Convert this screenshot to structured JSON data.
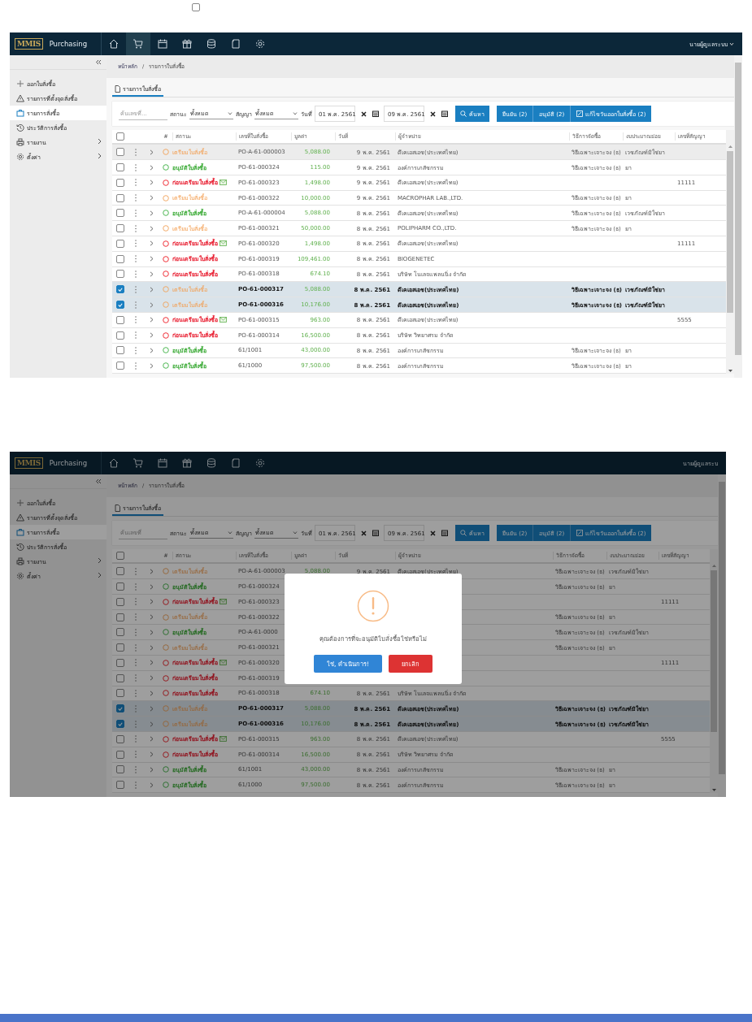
{
  "top_checkbox": {
    "checked": false
  },
  "screens": [
    {
      "header": {
        "logo_text": "MMIS",
        "app_title": "Purchasing",
        "user": "นายผู้ดูแลระบบ",
        "caret": true
      },
      "nav": [
        {
          "selected": false
        },
        {
          "selected": true
        },
        {
          "selected": false
        },
        {
          "selected": false
        },
        {
          "selected": false
        },
        {
          "selected": false
        },
        {
          "selected": false
        }
      ],
      "sidebar": [
        {
          "label": "ออกใบสั่งซื้อ",
          "selected": false,
          "expandable": false
        },
        {
          "label": "รายการที่ตั้งจุดสั่งซื้อ",
          "selected": false,
          "expandable": false
        },
        {
          "label": "รายการสั่งซื้อ",
          "selected": true,
          "expandable": false
        },
        {
          "label": "ประวัติการสั่งซื้อ",
          "selected": false,
          "expandable": false
        },
        {
          "label": "รายงาน",
          "selected": false,
          "expandable": true
        },
        {
          "label": "ตั้งค่า",
          "selected": false,
          "expandable": true
        }
      ],
      "breadcrumb": {
        "home": "หน้าหลัก",
        "separator": "/",
        "current": "รายการใบสั่งซื้อ"
      },
      "tabs": [
        {
          "label": "รายการใบสั่งซื้อ",
          "selected": true
        }
      ],
      "filter": {
        "search_placeholder": "ค้นเลขที่...",
        "status_label": "สถานะ",
        "status_value": "ทั้งหมด",
        "contract_label": "สัญญา",
        "contract_value": "ทั้งหมด",
        "date_label": "วันที่",
        "date_from": "01 พ.ค. 2561",
        "date_to": "09 พ.ค. 2561",
        "search_button": "ค้นหา",
        "actions": [
          "ยืนยัน (2)",
          "อนุมัติ (2)",
          "แก้ไขวันออกใบสั่งซื้อ (2)"
        ]
      },
      "table": {
        "all_checked": false,
        "columns": [
          "#",
          "สถานะ",
          "เลขที่ใบสั่งซื้อ",
          "มูลค่า",
          "วันที่",
          "ผู้จำหน่าย",
          "วิธีการจัดซื้อ",
          "งบประมาณย่อย",
          "เลขที่สัญญา"
        ],
        "rows": [
          {
            "selected": false,
            "highlighted": true,
            "status": {
              "kind": "prepare",
              "label": "เตรียมใบสั่งซื้อ"
            },
            "mail": false,
            "po": "PO-A-61-000003",
            "value": "5,088.00",
            "date": "9 พ.ค. 2561",
            "vendor": "ดีเคเอสเอช(ประเทศไทย)",
            "method": "วิธีเฉพาะเจาะจง (ธ)",
            "budget": "เวชภัณฑ์มิใช่ยา"
          },
          {
            "selected": false,
            "highlighted": false,
            "status": {
              "kind": "approved",
              "label": "อนุมัติใบสั่งซื้อ"
            },
            "mail": false,
            "po": "PO-61-000324",
            "value": "115.00",
            "date": "9 พ.ค. 2561",
            "vendor": "องค์การเภสัชกรรม",
            "method": "วิธีเฉพาะเจาะจง (ธ)",
            "budget": "ยา"
          },
          {
            "selected": false,
            "highlighted": false,
            "status": {
              "kind": "draft",
              "label": "ก่อนเตรียมใบสั่งซื้อ"
            },
            "mail": true,
            "po": "PO-61-000323",
            "value": "1,498.00",
            "date": "9 พ.ค. 2561",
            "vendor": "ดีเคเอสเอช(ประเทศไทย)",
            "contract": "11111"
          },
          {
            "selected": false,
            "highlighted": false,
            "status": {
              "kind": "prepare",
              "label": "เตรียมใบสั่งซื้อ"
            },
            "mail": false,
            "po": "PO-61-000322",
            "value": "10,000.00",
            "date": "9 พ.ค. 2561",
            "vendor": "MACROPHAR LAB.,LTD.",
            "method": "วิธีเฉพาะเจาะจง (ธ)",
            "budget": "ยา"
          },
          {
            "selected": false,
            "highlighted": false,
            "status": {
              "kind": "approved",
              "label": "อนุมัติใบสั่งซื้อ"
            },
            "mail": false,
            "po": "PO-A-61-000004",
            "value": "5,088.00",
            "date": "8 พ.ค. 2561",
            "vendor": "ดีเคเอสเอช(ประเทศไทย)",
            "method": "วิธีเฉพาะเจาะจง (ธ)",
            "budget": "เวชภัณฑ์มิใช่ยา"
          },
          {
            "selected": false,
            "highlighted": false,
            "status": {
              "kind": "prepare",
              "label": "เตรียมใบสั่งซื้อ"
            },
            "mail": false,
            "po": "PO-61-000321",
            "value": "50,000.00",
            "date": "8 พ.ค. 2561",
            "vendor": "POLIPHARM CO.,LTD.",
            "method": "วิธีเฉพาะเจาะจง (ธ)",
            "budget": "ยา"
          },
          {
            "selected": false,
            "highlighted": false,
            "status": {
              "kind": "draft",
              "label": "ก่อนเตรียมใบสั่งซื้อ"
            },
            "mail": true,
            "po": "PO-61-000320",
            "value": "1,498.00",
            "date": "8 พ.ค. 2561",
            "vendor": "ดีเคเอสเอช(ประเทศไทย)",
            "contract": "11111"
          },
          {
            "selected": false,
            "highlighted": false,
            "status": {
              "kind": "draft",
              "label": "ก่อนเตรียมใบสั่งซื้อ"
            },
            "mail": false,
            "po": "PO-61-000319",
            "value": "109,461.00",
            "date": "8 พ.ค. 2561",
            "vendor": "BIOGENETEC"
          },
          {
            "selected": false,
            "highlighted": false,
            "status": {
              "kind": "draft",
              "label": "ก่อนเตรียมใบสั่งซื้อ"
            },
            "mail": false,
            "po": "PO-61-000318",
            "value": "674.10",
            "date": "8 พ.ค. 2561",
            "vendor": "บริษัท โนเลจแพลนนิ่ง จำกัด"
          },
          {
            "selected": true,
            "highlighted": false,
            "status": {
              "kind": "prepare",
              "label": "เตรียมใบสั่งซื้อ"
            },
            "mail": false,
            "po": "PO-61-000317",
            "value": "5,088.00",
            "date": "8 พ.ค. 2561",
            "vendor": "ดีเคเอสเอช(ประเทศไทย)",
            "method": "วิธีเฉพาะเจาะจง (ธ)",
            "budget": "เวชภัณฑ์มิใช่ยา"
          },
          {
            "selected": true,
            "highlighted": false,
            "status": {
              "kind": "prepare",
              "label": "เตรียมใบสั่งซื้อ"
            },
            "mail": false,
            "po": "PO-61-000316",
            "value": "10,176.00",
            "date": "8 พ.ค. 2561",
            "vendor": "ดีเคเอสเอช(ประเทศไทย)",
            "method": "วิธีเฉพาะเจาะจง (ธ)",
            "budget": "เวชภัณฑ์มิใช่ยา"
          },
          {
            "selected": false,
            "highlighted": false,
            "status": {
              "kind": "draft",
              "label": "ก่อนเตรียมใบสั่งซื้อ"
            },
            "mail": true,
            "po": "PO-61-000315",
            "value": "963.00",
            "date": "8 พ.ค. 2561",
            "vendor": "ดีเคเอสเอช(ประเทศไทย)",
            "contract": "5555"
          },
          {
            "selected": false,
            "highlighted": false,
            "status": {
              "kind": "draft",
              "label": "ก่อนเตรียมใบสั่งซื้อ"
            },
            "mail": false,
            "po": "PO-61-000314",
            "value": "16,500.00",
            "date": "8 พ.ค. 2561",
            "vendor": "บริษัท วิทยาศรม จำกัด"
          },
          {
            "selected": false,
            "highlighted": false,
            "status": {
              "kind": "approved",
              "label": "อนุมัติใบสั่งซื้อ"
            },
            "mail": false,
            "po": "61/1001",
            "value": "43,000.00",
            "date": "8 พ.ค. 2561",
            "vendor": "องค์การเภสัชกรรม",
            "method": "วิธีเฉพาะเจาะจง (ธ)",
            "budget": "ยา"
          },
          {
            "selected": false,
            "highlighted": false,
            "status": {
              "kind": "approved",
              "label": "อนุมัติใบสั่งซื้อ"
            },
            "mail": false,
            "po": "61/1000",
            "value": "97,500.00",
            "date": "8 พ.ค. 2561",
            "vendor": "องค์การเภสัชกรรม",
            "method": "วิธีเฉพาะเจาะจง (ธ)",
            "budget": "ยา"
          }
        ]
      }
    },
    {
      "header": {
        "logo_text": "MMIS",
        "app_title": "Purchasing",
        "user": "นายผู้ดูแลระบ",
        "caret": false
      },
      "nav": [
        {
          "selected": false
        },
        {
          "selected": false
        },
        {
          "selected": false
        },
        {
          "selected": false
        },
        {
          "selected": false
        },
        {
          "selected": false
        },
        {
          "selected": false
        }
      ],
      "sidebar": [
        {
          "label": "ออกใบสั่งซื้อ",
          "selected": false,
          "expandable": false
        },
        {
          "label": "รายการที่ตั้งจุดสั่งซื้อ",
          "selected": false,
          "expandable": false
        },
        {
          "label": "รายการสั่งซื้อ",
          "selected": true,
          "expandable": false
        },
        {
          "label": "ประวัติการสั่งซื้อ",
          "selected": false,
          "expandable": false
        },
        {
          "label": "รายงาน",
          "selected": false,
          "expandable": true
        },
        {
          "label": "ตั้งค่า",
          "selected": false,
          "expandable": true
        }
      ],
      "breadcrumb": {
        "home": "หน้าหลัก",
        "separator": "/",
        "current": "รายการใบสั่งซื้อ"
      },
      "tabs": [
        {
          "label": "รายการใบสั่งซื้อ",
          "selected": true
        }
      ],
      "filter": {
        "search_placeholder": "ค้นเลขที่",
        "status_label": "สถานะ",
        "status_value": "ทั้งหมด",
        "contract_label": "สัญญา",
        "contract_value": "ทั้งหมด",
        "date_label": "วันที่",
        "date_from": "01 พ.ค. 2561",
        "date_to": "09 พ.ค. 2561",
        "search_button": "ค้นหา",
        "actions": [
          "ยืนยัน (2)",
          "อนุมัติ (2)",
          "แก้ไขวันออกใบสั่งซื้อ (2)"
        ]
      },
      "table": {
        "all_checked": false,
        "columns": [
          "#",
          "สถานะ",
          "เลขที่ใบสั่งซื้อ",
          "มูลค่า",
          "วันที่",
          "ผู้จำหน่าย",
          "วิธีการจัดซื้อ",
          "งบประมาณย่อย",
          "เลขที่สัญญา"
        ],
        "rows": [
          {
            "selected": false,
            "highlighted": false,
            "status": {
              "kind": "prepare",
              "label": "เตรียมใบสั่งซื้อ"
            },
            "mail": false,
            "po": "PO-A-61-000003",
            "value": "5,088.00",
            "date": "9 พ.ค. 2561",
            "vendor": "ดีเคเอสเอช(ประเทศไทย)",
            "method": "วิธีเฉพาะเจาะจง (ธ)",
            "budget": "เวชภัณฑ์มิใช่ยา"
          },
          {
            "selected": false,
            "highlighted": false,
            "status": {
              "kind": "approved",
              "label": "อนุมัติใบสั่งซื้อ"
            },
            "mail": false,
            "po": "PO-61-000324",
            "method": "วิธีเฉพาะเจาะจง (ธ)",
            "budget": "ยา"
          },
          {
            "selected": false,
            "highlighted": false,
            "status": {
              "kind": "draft",
              "label": "ก่อนเตรียมใบสั่งซื้อ"
            },
            "mail": true,
            "po": "PO-61-000323",
            "contract": "11111"
          },
          {
            "selected": false,
            "highlighted": false,
            "status": {
              "kind": "prepare",
              "label": "เตรียมใบสั่งซื้อ"
            },
            "mail": false,
            "po": "PO-61-000322",
            "method": "วิธีเฉพาะเจาะจง (ธ)",
            "budget": "ยา"
          },
          {
            "selected": false,
            "highlighted": false,
            "status": {
              "kind": "approved",
              "label": "อนุมัติใบสั่งซื้อ"
            },
            "mail": false,
            "po": "PO-A-61-0000",
            "method": "วิธีเฉพาะเจาะจง (ธ)",
            "budget": "เวชภัณฑ์มิใช่ยา"
          },
          {
            "selected": false,
            "highlighted": false,
            "status": {
              "kind": "prepare",
              "label": "เตรียมใบสั่งซื้อ"
            },
            "mail": false,
            "po": "PO-61-000321",
            "method": "วิธีเฉพาะเจาะจง (ธ)",
            "budget": "ยา"
          },
          {
            "selected": false,
            "highlighted": false,
            "status": {
              "kind": "draft",
              "label": "ก่อนเตรียมใบสั่งซื้อ"
            },
            "mail": true,
            "po": "PO-61-000320",
            "contract": "11111"
          },
          {
            "selected": false,
            "highlighted": false,
            "status": {
              "kind": "draft",
              "label": "ก่อนเตรียมใบสั่งซื้อ"
            },
            "mail": false,
            "po": "PO-61-000319"
          },
          {
            "selected": false,
            "highlighted": false,
            "status": {
              "kind": "draft",
              "label": "ก่อนเตรียมใบสั่งซื้อ"
            },
            "mail": false,
            "po": "PO-61-000318",
            "value": "674.10",
            "date": "8 พ.ค. 2561",
            "vendor": "บริษัท โนเลจแพลนนิ่ง จำกัด"
          },
          {
            "selected": true,
            "highlighted": false,
            "status": {
              "kind": "prepare",
              "label": "เตรียมใบสั่งซื้อ"
            },
            "mail": false,
            "po": "PO-61-000317",
            "value": "5,088.00",
            "date": "8 พ.ค. 2561",
            "vendor": "ดีเคเอสเอช(ประเทศไทย)",
            "method": "วิธีเฉพาะเจาะจง (ธ)",
            "budget": "เวชภัณฑ์มิใช่ยา"
          },
          {
            "selected": true,
            "highlighted": false,
            "status": {
              "kind": "prepare",
              "label": "เตรียมใบสั่งซื้อ"
            },
            "mail": false,
            "po": "PO-61-000316",
            "value": "10,176.00",
            "date": "8 พ.ค. 2561",
            "vendor": "ดีเคเอสเอช(ประเทศไทย)",
            "method": "วิธีเฉพาะเจาะจง (ธ)",
            "budget": "เวชภัณฑ์มิใช่ยา"
          },
          {
            "selected": false,
            "highlighted": false,
            "status": {
              "kind": "draft",
              "label": "ก่อนเตรียมใบสั่งซื้อ"
            },
            "mail": true,
            "po": "PO-61-000315",
            "value": "963.00",
            "date": "8 พ.ค. 2561",
            "vendor": "ดีเคเอสเอช(ประเทศไทย)",
            "contract": "5555"
          },
          {
            "selected": false,
            "highlighted": false,
            "status": {
              "kind": "draft",
              "label": "ก่อนเตรียมใบสั่งซื้อ"
            },
            "mail": false,
            "po": "PO-61-000314",
            "value": "16,500.00",
            "date": "8 พ.ค. 2561",
            "vendor": "บริษัท วิทยาศรม จำกัด"
          },
          {
            "selected": false,
            "highlighted": false,
            "status": {
              "kind": "approved",
              "label": "อนุมัติใบสั่งซื้อ"
            },
            "mail": false,
            "po": "61/1001",
            "value": "43,000.00",
            "date": "8 พ.ค. 2561",
            "vendor": "องค์การเภสัชกรรม",
            "method": "วิธีเฉพาะเจาะจง (ธ)",
            "budget": "ยา"
          },
          {
            "selected": false,
            "highlighted": false,
            "status": {
              "kind": "approved",
              "label": "อนุมัติใบสั่งซื้อ"
            },
            "mail": false,
            "po": "61/1000",
            "value": "97,500.00",
            "date": "8 พ.ค. 2561",
            "vendor": "องค์การเภสัชกรรม",
            "method": "วิธีเฉพาะเจาะจง (ธ)",
            "budget": "ยา"
          }
        ]
      },
      "dialog": {
        "message": "คุณต้องการที่จะอนุมัติใบสั่งซื้อใช่หรือไม่",
        "confirm": "ใช่, ดำเนินการ!",
        "cancel": "ยกเลิก"
      }
    }
  ]
}
